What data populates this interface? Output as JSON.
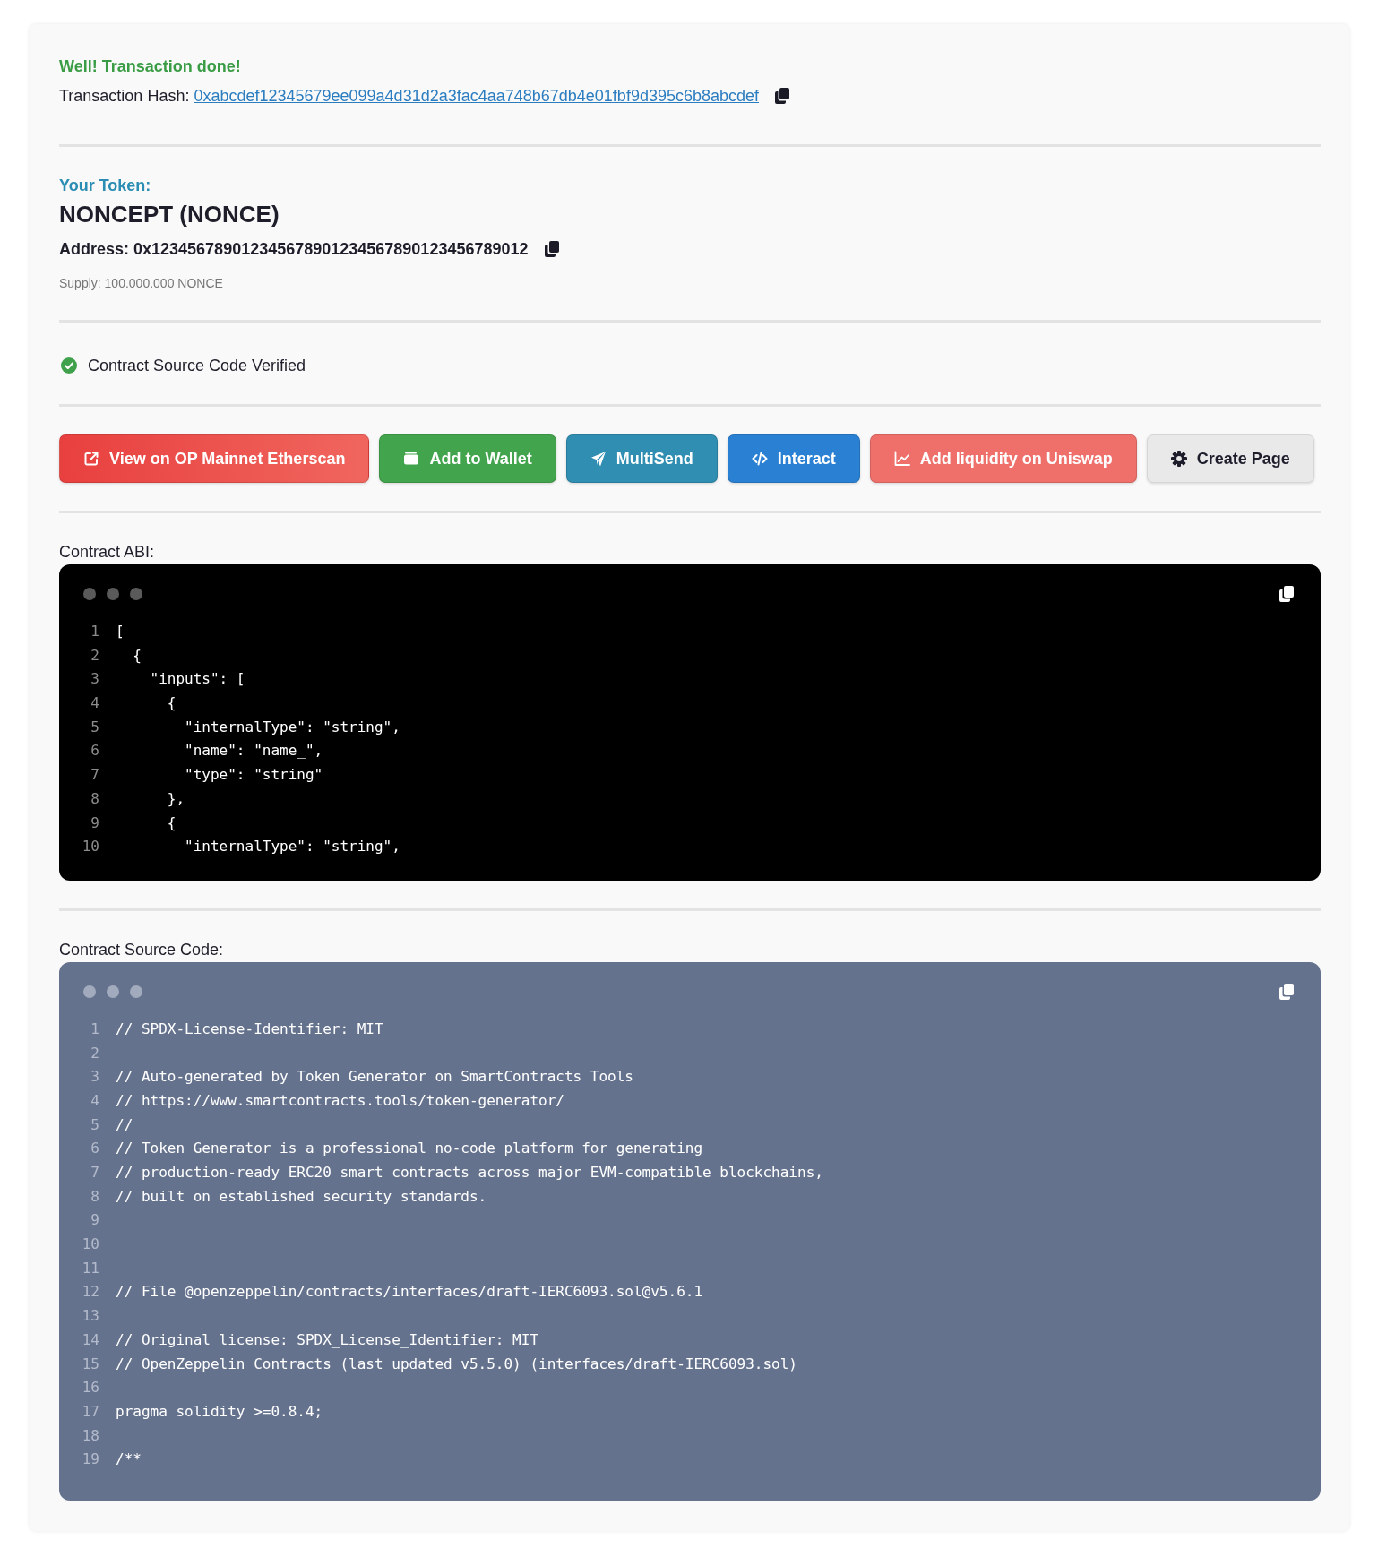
{
  "transaction": {
    "status": "Well! Transaction done!",
    "hash_label": "Transaction Hash:",
    "hash": "0xabcdef12345679ee099a4d31d2a3fac4aa748b67db4e01fbf9d395c6b8abcdef"
  },
  "token": {
    "heading": "Your Token:",
    "name": "NONCEPT (NONCE)",
    "address": "Address: 0x123456789012345678901234567890123456789012",
    "supply": "Supply: 100.000.000 NONCE"
  },
  "verification": {
    "verified": true,
    "label": "Contract Source Code Verified"
  },
  "actions": [
    {
      "kind": "explorer",
      "label": "View on OP Mainnet Etherscan"
    },
    {
      "kind": "wallet",
      "label": "Add to Wallet"
    },
    {
      "kind": "send",
      "label": "MultiSend"
    },
    {
      "kind": "interact",
      "label": "Interact"
    },
    {
      "kind": "liquidity",
      "label": "Add liquidity on Uniswap"
    },
    {
      "kind": "page",
      "label": "Create Page"
    }
  ],
  "code_blocks": [
    {
      "kind": "json",
      "title": "Contract ABI:",
      "lines": [
        {
          "number": "1",
          "text": "["
        },
        {
          "number": "2",
          "text": "  {"
        },
        {
          "number": "3",
          "text": "    \"inputs\": ["
        },
        {
          "number": "4",
          "text": "      {"
        },
        {
          "number": "5",
          "text": "        \"internalType\": \"string\","
        },
        {
          "number": "6",
          "text": "        \"name\": \"name_\","
        },
        {
          "number": "7",
          "text": "        \"type\": \"string\""
        },
        {
          "number": "8",
          "text": "      },"
        },
        {
          "number": "9",
          "text": "      {"
        },
        {
          "number": "10",
          "text": "        \"internalType\": \"string\","
        }
      ]
    },
    {
      "kind": "solidity",
      "title": "Contract Source Code:",
      "lines": [
        {
          "number": "1",
          "text": "// SPDX-License-Identifier: MIT"
        },
        {
          "number": "2"
        },
        {
          "number": "3",
          "text": "// Auto-generated by Token Generator on SmartContracts Tools"
        },
        {
          "number": "4",
          "text": "// https://www.smartcontracts.tools/token-generator/"
        },
        {
          "number": "5",
          "text": "//"
        },
        {
          "number": "6",
          "text": "// Token Generator is a professional no-code platform for generating"
        },
        {
          "number": "7",
          "text": "// production-ready ERC20 smart contracts across major EVM-compatible blockchains,"
        },
        {
          "number": "8",
          "text": "// built on established security standards."
        },
        {
          "number": "9"
        },
        {
          "number": "10"
        },
        {
          "number": "11"
        },
        {
          "number": "12",
          "text": "// File @openzeppelin/contracts/interfaces/draft-IERC6093.sol@v5.6.1"
        },
        {
          "number": "13"
        },
        {
          "number": "14",
          "text": "// Original license: SPDX_License_Identifier: MIT"
        },
        {
          "number": "15",
          "text": "// OpenZeppelin Contracts (last updated v5.5.0) (interfaces/draft-IERC6093.sol)"
        },
        {
          "number": "16"
        },
        {
          "number": "17",
          "text": "pragma solidity >=0.8.4;"
        },
        {
          "number": "18"
        },
        {
          "number": "19",
          "text": "/**"
        }
      ]
    }
  ]
}
